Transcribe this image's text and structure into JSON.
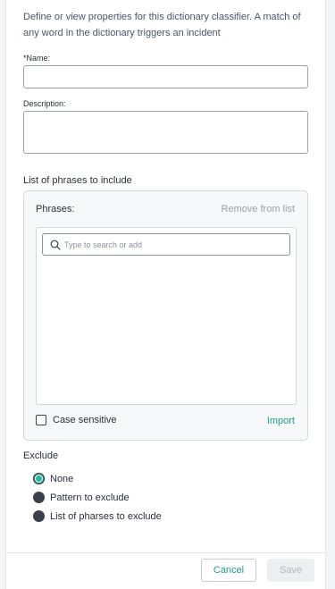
{
  "intro_text": "Define or view properties for this dictionary classifier. A match of any word in the dictionary triggers an incident",
  "name_field": {
    "label": "*Name:",
    "value": ""
  },
  "description_field": {
    "label": "Description:",
    "value": ""
  },
  "phrases_section": {
    "title": "List of phrases to include",
    "phrases_label": "Phrases:",
    "remove_link": "Remove from list",
    "search_placeholder": "Type to search or add",
    "case_sensitive_label": "Case sensitive",
    "case_sensitive_checked": false,
    "import_link": "Import"
  },
  "exclude_section": {
    "title": "Exclude",
    "options": [
      {
        "label": "None",
        "selected": true
      },
      {
        "label": "Pattern to exclude",
        "selected": false
      },
      {
        "label": "List of pharses to exclude",
        "selected": false
      }
    ]
  },
  "footer": {
    "cancel_label": "Cancel",
    "save_label": "Save"
  },
  "colors": {
    "accent": "#1f9d8b",
    "selected_radio": "#29b7a3",
    "radio": "#3a414a"
  }
}
